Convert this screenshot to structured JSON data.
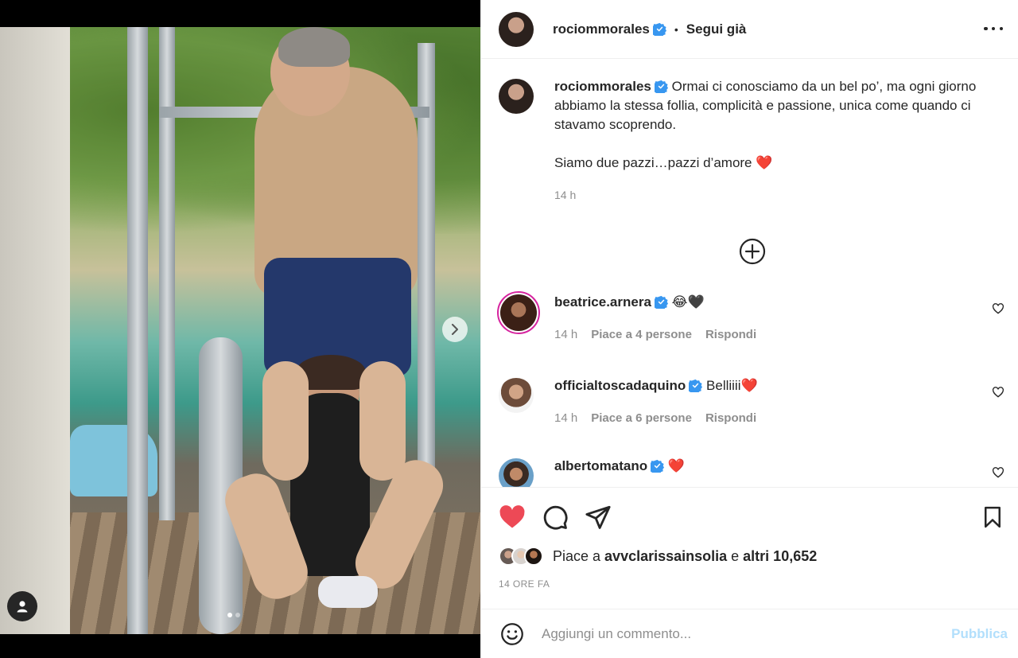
{
  "post": {
    "author": "rociommorales",
    "follow_status": "Segui già",
    "separator": "•"
  },
  "caption": {
    "author": "rociommorales",
    "paragraph1": "Ormai ci conosciamo da un bel po’, ma ogni giorno abbiamo la stessa follia, complicità e passione, unica come quando ci stavamo scoprendo.",
    "paragraph2": "Siamo due pazzi…pazzi d’amore",
    "paragraph2_emoji": "❤️",
    "time": "14 h"
  },
  "comments": [
    {
      "username": "beatrice.arnera",
      "text": "😂🖤",
      "time": "14 h",
      "likes": "Piace a 4 persone",
      "reply": "Rispondi"
    },
    {
      "username": "officialtoscadaquino",
      "text": "Belliiii❤️",
      "time": "14 h",
      "likes": "Piace a 6 persone",
      "reply": "Rispondi"
    },
    {
      "username": "albertomatano",
      "text": "❤️"
    }
  ],
  "likes": {
    "prefix": "Piace a ",
    "first_user": "avvclarissainsolia",
    "joiner": " e ",
    "others": "altri 10,652"
  },
  "timestamp": "14 ORE FA",
  "add_comment": {
    "placeholder": "Aggiungi un commento...",
    "publish": "Pubblica"
  },
  "carousel": {
    "current": 1,
    "total": 2
  },
  "colors": {
    "like_red": "#ed4956",
    "verified_blue": "#3897f0",
    "publish_disabled": "#b2dffc",
    "muted": "#8e8e8e"
  }
}
